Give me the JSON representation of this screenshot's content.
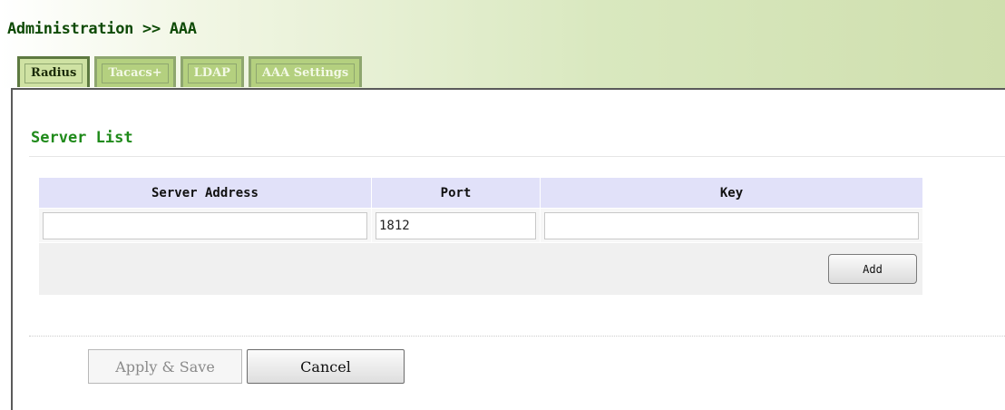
{
  "breadcrumb": "Administration >> AAA",
  "tabs": [
    {
      "label": "Radius",
      "active": true
    },
    {
      "label": "Tacacs+",
      "active": false
    },
    {
      "label": "LDAP",
      "active": false
    },
    {
      "label": "AAA Settings",
      "active": false
    }
  ],
  "section": {
    "title": "Server List"
  },
  "table": {
    "headers": [
      "Server Address",
      "Port",
      "Key"
    ],
    "row": {
      "server_address": "",
      "port": "1812",
      "key": ""
    },
    "add_label": "Add"
  },
  "actions": {
    "apply_label": "Apply & Save",
    "cancel_label": "Cancel"
  },
  "colors": {
    "title_green": "#1f8a1a",
    "tab_active": "#cfe2a3",
    "header_bg": "#e1e1f9"
  }
}
